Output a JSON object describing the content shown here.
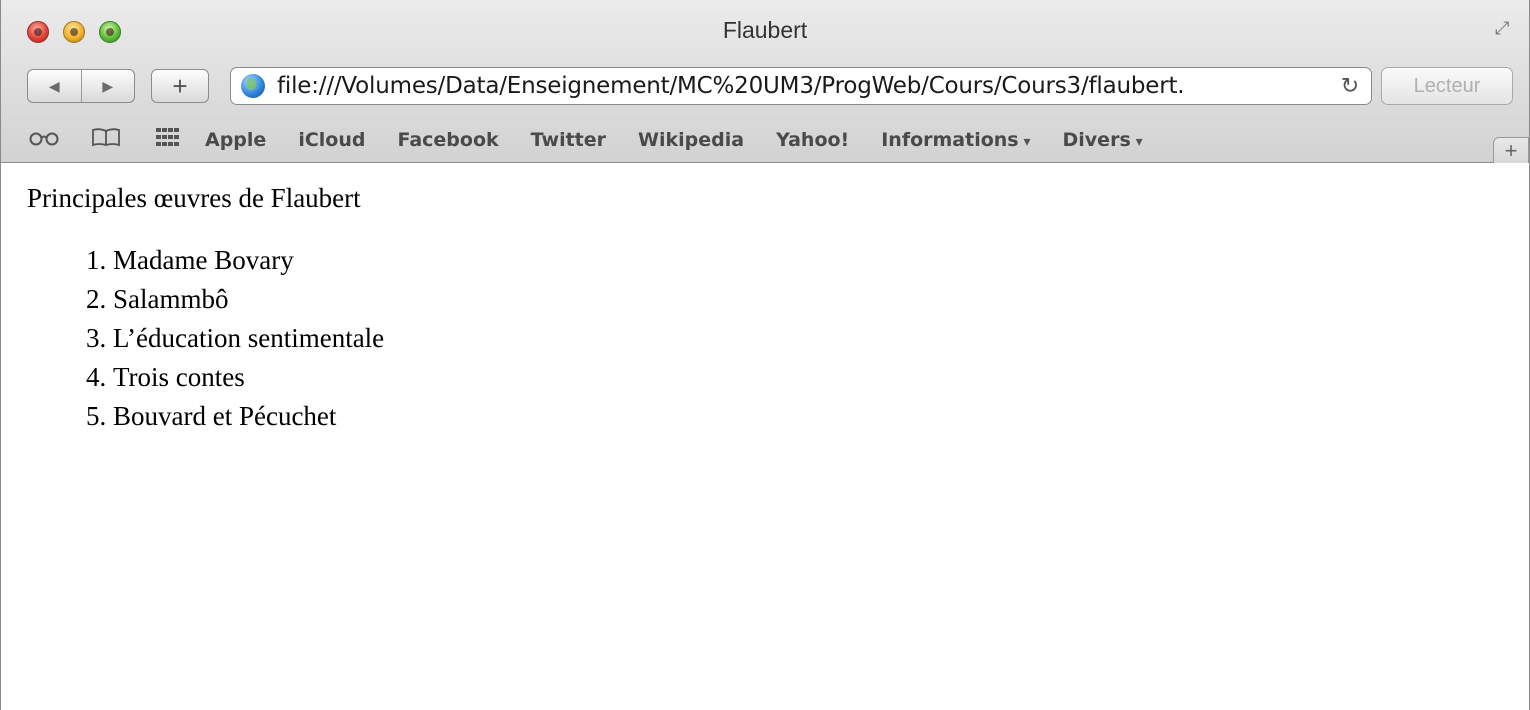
{
  "window": {
    "title": "Flaubert"
  },
  "toolbar": {
    "url": "file:///Volumes/Data/Enseignement/MC%20UM3/ProgWeb/Cours/Cours3/flaubert.",
    "reader_label": "Lecteur",
    "back_icon": "◀",
    "forward_icon": "▶",
    "add_icon": "+",
    "reload_icon": "↻"
  },
  "bookmarks": {
    "items": [
      {
        "label": "Apple"
      },
      {
        "label": "iCloud"
      },
      {
        "label": "Facebook"
      },
      {
        "label": "Twitter"
      },
      {
        "label": "Wikipedia"
      },
      {
        "label": "Yahoo!"
      },
      {
        "label": "Informations"
      },
      {
        "label": "Divers"
      }
    ],
    "new_tab_icon": "+"
  },
  "content": {
    "heading": "Principales œuvres de Flaubert",
    "works": [
      "Madame Bovary",
      "Salammbô",
      "L’éducation sentimentale",
      "Trois contes",
      "Bouvard et Pécuchet"
    ]
  }
}
